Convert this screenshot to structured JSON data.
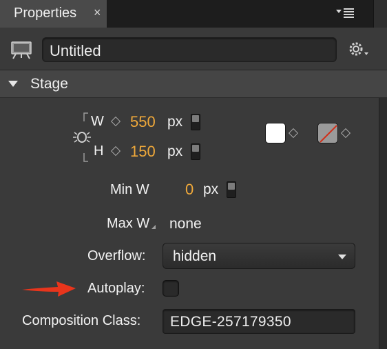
{
  "tab": {
    "label": "Properties",
    "close": "×"
  },
  "header": {
    "title_value": "Untitled"
  },
  "section": {
    "label": "Stage"
  },
  "dimensions": {
    "w_label": "W",
    "w_value": "550",
    "w_unit": "px",
    "h_label": "H",
    "h_value": "150",
    "h_unit": "px"
  },
  "min_w": {
    "label": "Min W",
    "value": "0",
    "unit": "px"
  },
  "max_w": {
    "label": "Max W",
    "value": "none"
  },
  "overflow": {
    "label": "Overflow:",
    "value": "hidden"
  },
  "autoplay": {
    "label": "Autoplay:",
    "checked": false
  },
  "composition_class": {
    "label": "Composition Class:",
    "value": "EDGE-257179350"
  },
  "colors": {
    "background_swatch": "#ffffff",
    "accent_value": "#f0a93a",
    "annotation_arrow": "#e8351c"
  },
  "icons": [
    "close-icon",
    "panel-menu-icon",
    "stage-icon",
    "gear-icon",
    "disclosure-triangle-icon",
    "link-dimensions-icon",
    "keyframe-diamond-icon",
    "no-color-icon",
    "annotation-arrow"
  ]
}
